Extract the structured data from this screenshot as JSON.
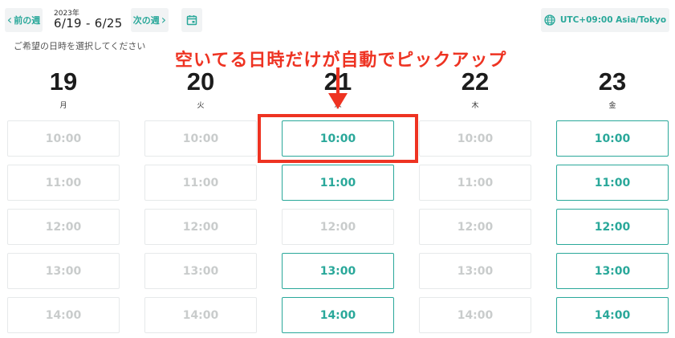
{
  "header": {
    "prev_week": "前の週",
    "year": "2023年",
    "range": "6/19 - 6/25",
    "next_week": "次の週",
    "timezone": "UTC+09:00 Asia/Tokyo"
  },
  "prompt": "ご希望の日時を選択してください",
  "annotation": {
    "text": "空いてる日時だけが自動でピックアップ"
  },
  "colors": {
    "accent": "#2aa89a",
    "annotation": "#ee3322",
    "disabled_text": "#c9cccc"
  },
  "days": [
    {
      "date": "19",
      "weekday": "月",
      "slots": [
        {
          "time": "10:00",
          "available": false
        },
        {
          "time": "11:00",
          "available": false
        },
        {
          "time": "12:00",
          "available": false
        },
        {
          "time": "13:00",
          "available": false
        },
        {
          "time": "14:00",
          "available": false
        }
      ]
    },
    {
      "date": "20",
      "weekday": "火",
      "slots": [
        {
          "time": "10:00",
          "available": false
        },
        {
          "time": "11:00",
          "available": false
        },
        {
          "time": "12:00",
          "available": false
        },
        {
          "time": "13:00",
          "available": false
        },
        {
          "time": "14:00",
          "available": false
        }
      ]
    },
    {
      "date": "21",
      "weekday": "水",
      "slots": [
        {
          "time": "10:00",
          "available": true
        },
        {
          "time": "11:00",
          "available": true
        },
        {
          "time": "12:00",
          "available": false
        },
        {
          "time": "13:00",
          "available": true
        },
        {
          "time": "14:00",
          "available": true
        }
      ]
    },
    {
      "date": "22",
      "weekday": "木",
      "slots": [
        {
          "time": "10:00",
          "available": false
        },
        {
          "time": "11:00",
          "available": false
        },
        {
          "time": "12:00",
          "available": false
        },
        {
          "time": "13:00",
          "available": false
        },
        {
          "time": "14:00",
          "available": false
        }
      ]
    },
    {
      "date": "23",
      "weekday": "金",
      "slots": [
        {
          "time": "10:00",
          "available": true
        },
        {
          "time": "11:00",
          "available": true
        },
        {
          "time": "12:00",
          "available": true
        },
        {
          "time": "13:00",
          "available": true
        },
        {
          "time": "14:00",
          "available": true
        }
      ]
    }
  ]
}
